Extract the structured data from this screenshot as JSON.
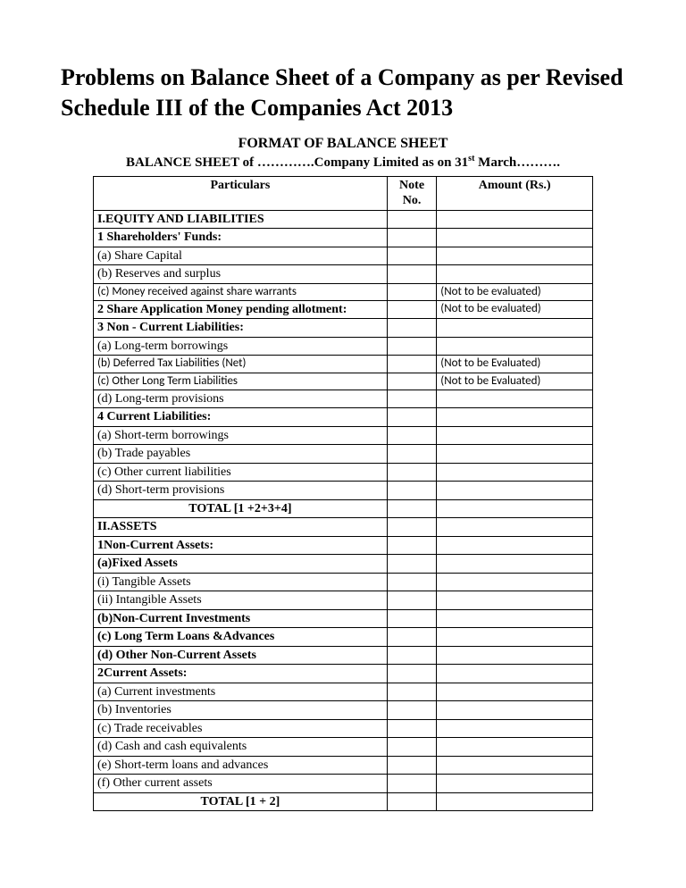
{
  "title": "Problems on Balance Sheet of a Company as per Revised Schedule III of the Companies Act 2013",
  "subtitle": "FORMAT OF BALANCE SHEET",
  "sheetline_pre": "BALANCE SHEET of ………….Company Limited as on 31",
  "sheetline_sup": "st",
  "sheetline_post": " March……….",
  "headers": {
    "particulars": "Particulars",
    "note": "Note No.",
    "amount": "Amount (Rs.)"
  },
  "rows": [
    {
      "p": "I.EQUITY AND LIABILITIES",
      "cls": "bold",
      "amt": ""
    },
    {
      "p": "1 Shareholders' Funds:",
      "cls": "bold",
      "amt": ""
    },
    {
      "p": "(a) Share Capital",
      "cls": "pad1",
      "amt": ""
    },
    {
      "p": "(b) Reserves and surplus",
      "cls": "pad1",
      "amt": ""
    },
    {
      "p": "(c) Money received against share warrants",
      "cls": "pad1 calibri",
      "amt": "(Not to be evaluated)",
      "amtcls": "calibri"
    },
    {
      "p": "2 Share Application Money pending allotment:",
      "cls": "bold",
      "amt": "(Not to be evaluated)",
      "amtcls": "calibri"
    },
    {
      "p": "3 Non - Current  Liabilities:",
      "cls": "bold",
      "amt": ""
    },
    {
      "p": "(a) Long-term borrowings",
      "cls": "pad1",
      "amt": ""
    },
    {
      "p": "(b) Deferred Tax Liabilities (Net)",
      "cls": "pad1 calibri",
      "amt": "(Not to be Evaluated)",
      "amtcls": "calibri"
    },
    {
      "p": "(c) Other Long Term Liabilities",
      "cls": "pad1 calibri",
      "amt": "(Not to be Evaluated)",
      "amtcls": "calibri"
    },
    {
      "p": "(d) Long-term provisions",
      "cls": "pad1",
      "amt": ""
    },
    {
      "p": "4 Current  Liabilities:",
      "cls": "bold",
      "amt": ""
    },
    {
      "p": "(a) Short-term borrowings",
      "cls": "pad1",
      "amt": ""
    },
    {
      "p": "(b) Trade payables",
      "cls": "pad1",
      "amt": ""
    },
    {
      "p": "(c) Other current liabilities",
      "cls": "pad1",
      "amt": ""
    },
    {
      "p": "(d) Short-term provisions",
      "cls": "pad1",
      "amt": ""
    },
    {
      "p": "TOTAL [1 +2+3+4]",
      "cls": "bold center",
      "amt": ""
    },
    {
      "p": "II.ASSETS",
      "cls": "bold",
      "amt": ""
    },
    {
      "p": "1Non-Current Assets:",
      "cls": "bold",
      "amt": ""
    },
    {
      "p": "(a)Fixed Assets",
      "cls": "bold pad1",
      "amt": ""
    },
    {
      "p": "(i)  Tangible Assets",
      "cls": "pad2",
      "amt": ""
    },
    {
      "p": "(ii) Intangible Assets",
      "cls": "pad2",
      "amt": ""
    },
    {
      "p": "(b)Non-Current Investments",
      "cls": "bold pad1",
      "amt": ""
    },
    {
      "p": "(c) Long Term Loans &Advances",
      "cls": "bold pad1",
      "amt": ""
    },
    {
      "p": "(d) Other Non-Current Assets",
      "cls": "bold pad1",
      "amt": ""
    },
    {
      "p": "2Current Assets:",
      "cls": "bold",
      "amt": ""
    },
    {
      "p": "(a) Current investments",
      "cls": "pad1",
      "amt": ""
    },
    {
      "p": "(b) Inventories",
      "cls": "pad1",
      "amt": ""
    },
    {
      "p": "(c) Trade receivables",
      "cls": "pad1",
      "amt": ""
    },
    {
      "p": "(d) Cash and cash equivalents",
      "cls": "pad1",
      "amt": ""
    },
    {
      "p": "(e) Short-term loans and advances",
      "cls": "pad1",
      "amt": ""
    },
    {
      "p": "(f) Other current assets",
      "cls": "pad1",
      "amt": ""
    },
    {
      "p": "TOTAL    [1 + 2]",
      "cls": "bold center",
      "amt": ""
    }
  ]
}
